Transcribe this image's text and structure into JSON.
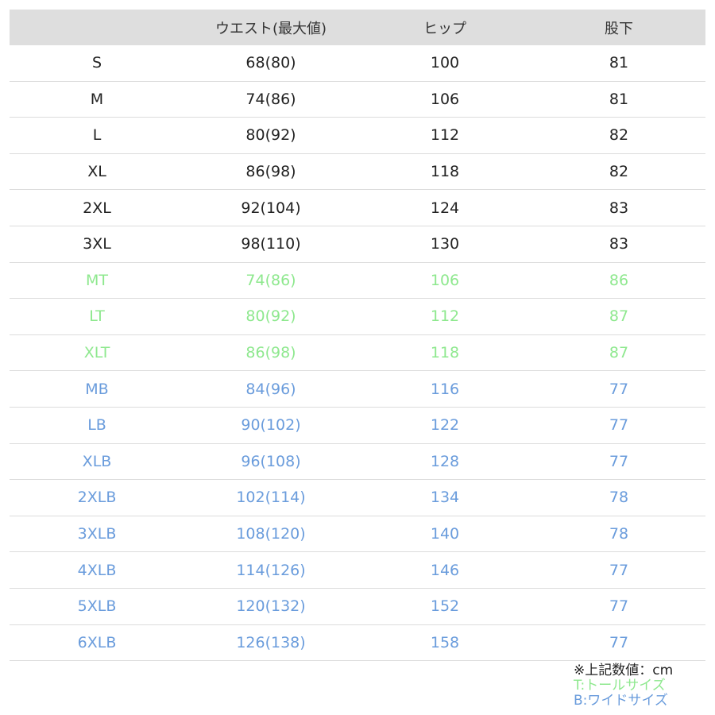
{
  "colors": {
    "black": "#222222",
    "green": "#8ee88e",
    "blue": "#6a9cdc",
    "header_bg": "#dedede"
  },
  "header": [
    "",
    "ウエスト(最大値)",
    "ヒップ",
    "股下"
  ],
  "rows": [
    {
      "size": "S",
      "waist": "68(80)",
      "hip": "100",
      "inseam": "81",
      "color": "black"
    },
    {
      "size": "M",
      "waist": "74(86)",
      "hip": "106",
      "inseam": "81",
      "color": "black"
    },
    {
      "size": "L",
      "waist": "80(92)",
      "hip": "112",
      "inseam": "82",
      "color": "black"
    },
    {
      "size": "XL",
      "waist": "86(98)",
      "hip": "118",
      "inseam": "82",
      "color": "black"
    },
    {
      "size": "2XL",
      "waist": "92(104)",
      "hip": "124",
      "inseam": "83",
      "color": "black"
    },
    {
      "size": "3XL",
      "waist": "98(110)",
      "hip": "130",
      "inseam": "83",
      "color": "black"
    },
    {
      "size": "MT",
      "waist": "74(86)",
      "hip": "106",
      "inseam": "86",
      "color": "green"
    },
    {
      "size": "LT",
      "waist": "80(92)",
      "hip": "112",
      "inseam": "87",
      "color": "green"
    },
    {
      "size": "XLT",
      "waist": "86(98)",
      "hip": "118",
      "inseam": "87",
      "color": "green"
    },
    {
      "size": "MB",
      "waist": "84(96)",
      "hip": "116",
      "inseam": "77",
      "color": "blue"
    },
    {
      "size": "LB",
      "waist": "90(102)",
      "hip": "122",
      "inseam": "77",
      "color": "blue"
    },
    {
      "size": "XLB",
      "waist": "96(108)",
      "hip": "128",
      "inseam": "77",
      "color": "blue"
    },
    {
      "size": "2XLB",
      "waist": "102(114)",
      "hip": "134",
      "inseam": "78",
      "color": "blue"
    },
    {
      "size": "3XLB",
      "waist": "108(120)",
      "hip": "140",
      "inseam": "78",
      "color": "blue"
    },
    {
      "size": "4XLB",
      "waist": "114(126)",
      "hip": "146",
      "inseam": "77",
      "color": "blue"
    },
    {
      "size": "5XLB",
      "waist": "120(132)",
      "hip": "152",
      "inseam": "77",
      "color": "blue"
    },
    {
      "size": "6XLB",
      "waist": "126(138)",
      "hip": "158",
      "inseam": "77",
      "color": "blue"
    }
  ],
  "notes": {
    "unit": "※上記数値：cm",
    "tall": "T:トールサイズ",
    "big": "B:ワイドサイズ"
  }
}
